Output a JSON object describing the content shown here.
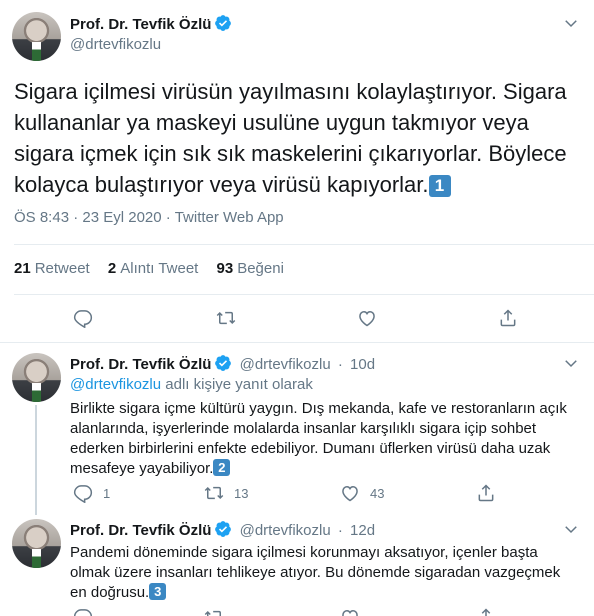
{
  "main_tweet": {
    "author_name": "Prof. Dr. Tevfik Özlü",
    "author_handle": "@drtevfikozlu",
    "text": "Sigara içilmesi virüsün yayılmasını kolaylaştırıyor. Sigara kullananlar ya maskeyi usulüne uygun takmıyor veya sigara içmek için sık sık maskelerini çıkarıyorlar. Böylece kolayca bulaştırıyor veya virüsü kapıyorlar.",
    "badge": "1",
    "time": "ÖS 8:43",
    "date": "23 Eyl 2020",
    "source": "Twitter Web App",
    "separator": " · ",
    "stats": {
      "retweets_count": "21",
      "retweets_label": "Retweet",
      "quotes_count": "2",
      "quotes_label": "Alıntı Tweet",
      "likes_count": "93",
      "likes_label": "Beğeni"
    }
  },
  "replies": [
    {
      "author_name": "Prof. Dr. Tevfik Özlü",
      "author_handle": "@drtevfikozlu",
      "age": "10d",
      "dot": "·",
      "reply_to_handle": "@drtevfikozlu",
      "reply_to_suffix": " adlı kişiye yanıt olarak",
      "text": "Birlikte sigara içme kültürü yaygın. Dış mekanda, kafe ve restoranların açık alanlarında, işyerlerinde molalarda insanlar karşılıklı sigara içip sohbet ederken birbirlerini enfekte edebiliyor. Dumanı üflerken virüsü daha uzak mesafeye yayabiliyor.",
      "badge": "2",
      "reply_count": "1",
      "retweet_count": "13",
      "like_count": "43"
    },
    {
      "author_name": "Prof. Dr. Tevfik Özlü",
      "author_handle": "@drtevfikozlu",
      "age": "12d",
      "dot": "·",
      "text": "Pandemi döneminde sigara içilmesi korunmayı aksatıyor, içenler başta olmak üzere insanları tehlikeye atıyor. Bu dönemde sigaradan vazgeçmek en doğrusu.",
      "badge": "3",
      "reply_count": "",
      "retweet_count": "",
      "like_count": ""
    }
  ],
  "colors": {
    "accent": "#1da1f2",
    "text_primary": "#14171a",
    "text_secondary": "#657786",
    "divider": "#e6ecf0",
    "badge": "#3b88c3"
  },
  "icons": {
    "verified": "verified-badge-icon",
    "chevron": "chevron-down-icon",
    "reply": "reply-icon",
    "retweet": "retweet-icon",
    "like": "like-icon",
    "share": "share-icon"
  }
}
